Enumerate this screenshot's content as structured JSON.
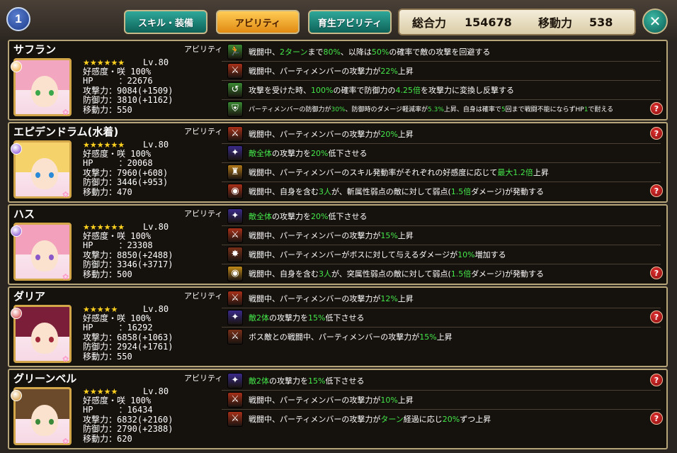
{
  "header": {
    "page_number": "1",
    "tabs": [
      {
        "label": "スキル・装備"
      },
      {
        "label": "アビリティ"
      },
      {
        "label": "育生アビリティ"
      }
    ],
    "total_power_label": "総合力",
    "total_power_value": "154678",
    "move_power_label": "移動力",
    "move_power_value": "538",
    "close_icon": "close-icon"
  },
  "ability_label": "アビリティ",
  "characters": [
    {
      "name": "サフラン",
      "element_color": "#f0a020",
      "hair_color": "#f2a6bf",
      "eye_color": "#3aa84a",
      "stars": "★★★★★★",
      "level": "Lv.80",
      "affection": "好感度・咲 100%",
      "hp": "HP　　　：22676",
      "atk": "攻撃力：9084(+1509)",
      "def": "防御力：3810(+1162)",
      "move": "移動力：550",
      "abilities": [
        {
          "icon": "evade-icon",
          "color": "#3a8a32",
          "parts": [
            "戦闘中、",
            "2ターン",
            "まで",
            "80%",
            "、以降は",
            "50%",
            "の確率で敵の攻撃を回避する"
          ]
        },
        {
          "icon": "attack-up-icon",
          "color": "#a83018",
          "parts": [
            "戦闘中、パーティメンバーの攻撃力が",
            "22%",
            "上昇"
          ]
        },
        {
          "icon": "counter-icon",
          "color": "#3a8a32",
          "parts": [
            "攻撃を受けた時、",
            "100%",
            "の確率で防御力の",
            "4.25倍",
            "を攻撃力に変換し反撃する"
          ]
        },
        {
          "icon": "guard-icon",
          "color": "#3a8a32",
          "small": true,
          "parts": [
            "パーティメンバーの防御力が",
            "30%",
            "、防御時のダメージ軽減率が",
            "5.3%",
            "上昇、自身は確率で",
            "5",
            "回まで戦闘不能にならずHP",
            "1",
            "で耐える"
          ]
        }
      ]
    },
    {
      "name": "エピデンドラム(水着)",
      "element_color": "#7a3ad0",
      "hair_color": "#f5d36a",
      "eye_color": "#2a8ad8",
      "stars": "★★★★★★",
      "level": "Lv.80",
      "affection": "好感度・咲 100%",
      "hp": "HP　　　：20068",
      "atk": "攻撃力：7960(+608)",
      "def": "防御力：3446(+953)",
      "move": "移動力：470",
      "abilities": [
        {
          "icon": "attack-up-icon",
          "color": "#a83018",
          "parts": [
            "戦闘中、パーティメンバーの攻撃力が",
            "20%",
            "上昇"
          ]
        },
        {
          "icon": "debuff-icon",
          "color": "#3a2a8a",
          "parts": [
            "",
            "敵全体",
            "の攻撃力を",
            "20%",
            "低下させる"
          ]
        },
        {
          "icon": "skill-rate-icon",
          "color": "#b07818",
          "parts": [
            "戦闘中、パーティメンバーのスキル発動率がそれぞれの好感度に応じて",
            "最大1.2倍",
            "上昇"
          ]
        },
        {
          "icon": "weakness-icon",
          "color": "#a83018",
          "parts": [
            "戦闘中、自身を含む",
            "3人",
            "が、斬属性弱点の敵に対して弱点(",
            "1.5倍",
            "ダメージ)が発動する"
          ]
        }
      ]
    },
    {
      "name": "ハス",
      "element_color": "#7a3ad0",
      "hair_color": "#f2a0bc",
      "eye_color": "#8a58c8",
      "stars": "★★★★★★",
      "level": "Lv.80",
      "affection": "好感度・咲 100%",
      "hp": "HP　　　：23308",
      "atk": "攻撃力：8850(+2488)",
      "def": "防御力：3346(+3717)",
      "move": "移動力：500",
      "abilities": [
        {
          "icon": "debuff-icon",
          "color": "#3a2a8a",
          "parts": [
            "",
            "敵全体",
            "の攻撃力を",
            "20%",
            "低下させる"
          ]
        },
        {
          "icon": "attack-up-icon",
          "color": "#a83018",
          "parts": [
            "戦闘中、パーティメンバーの攻撃力が",
            "15%",
            "上昇"
          ]
        },
        {
          "icon": "boss-damage-icon",
          "color": "#7a3018",
          "parts": [
            "戦闘中、パーティメンバーがボスに対して与えるダメージが",
            "10%",
            "増加する"
          ]
        },
        {
          "icon": "weakness-icon",
          "color": "#c08a18",
          "parts": [
            "戦闘中、自身を含む",
            "3人",
            "が、突属性弱点の敵に対して弱点(",
            "1.5倍",
            "ダメージ)が発動する"
          ]
        }
      ]
    },
    {
      "name": "ダリア",
      "element_color": "#d03030",
      "hair_color": "#7a1e3a",
      "eye_color": "#a02838",
      "stars": "★★★★★",
      "level": "Lv.80",
      "affection": "好感度・咲 100%",
      "hp": "HP　　　：16292",
      "atk": "攻撃力：6858(+1063)",
      "def": "防御力：2924(+1761)",
      "move": "移動力：550",
      "abilities": [
        {
          "icon": "attack-up-icon",
          "color": "#a83018",
          "parts": [
            "戦闘中、パーティメンバーの攻撃力が",
            "12%",
            "上昇"
          ]
        },
        {
          "icon": "debuff-icon",
          "color": "#3a2a8a",
          "parts": [
            "",
            "敵2体",
            "の攻撃力を",
            "15%",
            "低下させる"
          ]
        },
        {
          "icon": "boss-attack-icon",
          "color": "#7a3018",
          "parts": [
            "ボス敵との戦闘中、パーティメンバーの攻撃力が",
            "15%",
            "上昇"
          ]
        }
      ]
    },
    {
      "name": "グリーンベル",
      "element_color": "#d08a20",
      "hair_color": "#6a4a2a",
      "eye_color": "#3a8a3a",
      "stars": "★★★★★",
      "level": "Lv.80",
      "affection": "好感度・咲 100%",
      "hp": "HP　　　：16434",
      "atk": "攻撃力：6832(+2160)",
      "def": "防御力：2790(+2388)",
      "move": "移動力：620",
      "abilities": [
        {
          "icon": "debuff-icon",
          "color": "#3a2a8a",
          "parts": [
            "",
            "敵2体",
            "の攻撃力を",
            "15%",
            "低下させる"
          ]
        },
        {
          "icon": "attack-up-icon",
          "color": "#a83018",
          "parts": [
            "戦闘中、パーティメンバーの攻撃力が",
            "10%",
            "上昇"
          ]
        },
        {
          "icon": "attack-up-icon",
          "color": "#a83018",
          "parts": [
            "戦闘中、パーティメンバーの攻撃力が",
            "ターン",
            "経過に応じ",
            "20%",
            "ずつ上昇"
          ]
        }
      ]
    }
  ]
}
